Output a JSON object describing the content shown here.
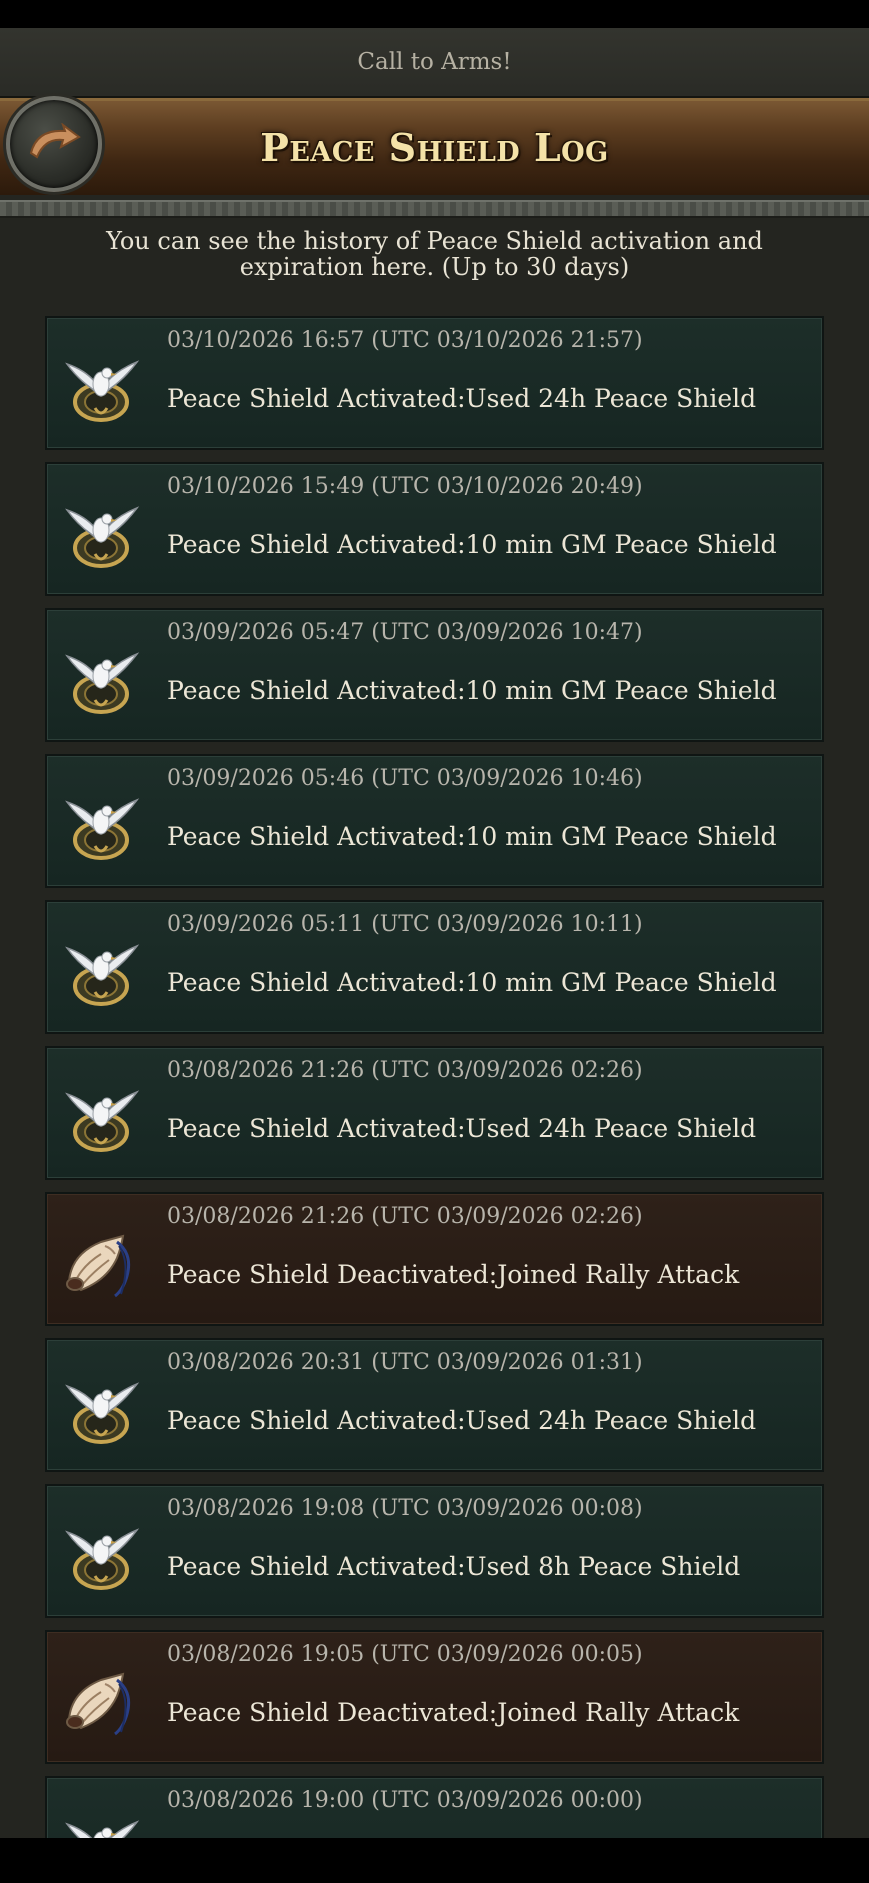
{
  "banner": {
    "text": "Call to Arms!"
  },
  "header": {
    "title": "Peace Shield Log"
  },
  "description": "You can see the history of Peace Shield activation and expiration here. (Up to 30 days)",
  "entries": [
    {
      "type": "activated",
      "icon": "dove-shield-icon",
      "time": "03/10/2026 16:57 (UTC 03/10/2026 21:57)",
      "message": "Peace Shield Activated:Used 24h Peace Shield"
    },
    {
      "type": "activated",
      "icon": "dove-shield-icon",
      "time": "03/10/2026 15:49 (UTC 03/10/2026 20:49)",
      "message": "Peace Shield Activated:10 min GM Peace Shield"
    },
    {
      "type": "activated",
      "icon": "dove-shield-icon",
      "time": "03/09/2026 05:47 (UTC 03/09/2026 10:47)",
      "message": "Peace Shield Activated:10 min GM Peace Shield"
    },
    {
      "type": "activated",
      "icon": "dove-shield-icon",
      "time": "03/09/2026 05:46 (UTC 03/09/2026 10:46)",
      "message": "Peace Shield Activated:10 min GM Peace Shield"
    },
    {
      "type": "activated",
      "icon": "dove-shield-icon",
      "time": "03/09/2026 05:11 (UTC 03/09/2026 10:11)",
      "message": "Peace Shield Activated:10 min GM Peace Shield"
    },
    {
      "type": "activated",
      "icon": "dove-shield-icon",
      "time": "03/08/2026 21:26 (UTC 03/09/2026 02:26)",
      "message": "Peace Shield Activated:Used 24h Peace Shield"
    },
    {
      "type": "deactivated",
      "icon": "war-horn-icon",
      "time": "03/08/2026 21:26 (UTC 03/09/2026 02:26)",
      "message": "Peace Shield Deactivated:Joined Rally Attack"
    },
    {
      "type": "activated",
      "icon": "dove-shield-icon",
      "time": "03/08/2026 20:31 (UTC 03/09/2026 01:31)",
      "message": "Peace Shield Activated:Used 24h Peace Shield"
    },
    {
      "type": "activated",
      "icon": "dove-shield-icon",
      "time": "03/08/2026 19:08 (UTC 03/09/2026 00:08)",
      "message": "Peace Shield Activated:Used 8h Peace Shield"
    },
    {
      "type": "deactivated",
      "icon": "war-horn-icon",
      "time": "03/08/2026 19:05 (UTC 03/09/2026 00:05)",
      "message": "Peace Shield Deactivated:Joined Rally Attack"
    },
    {
      "type": "activated",
      "icon": "dove-shield-icon",
      "time": "03/08/2026 19:00 (UTC 03/09/2026 00:00)",
      "message": ""
    }
  ]
}
